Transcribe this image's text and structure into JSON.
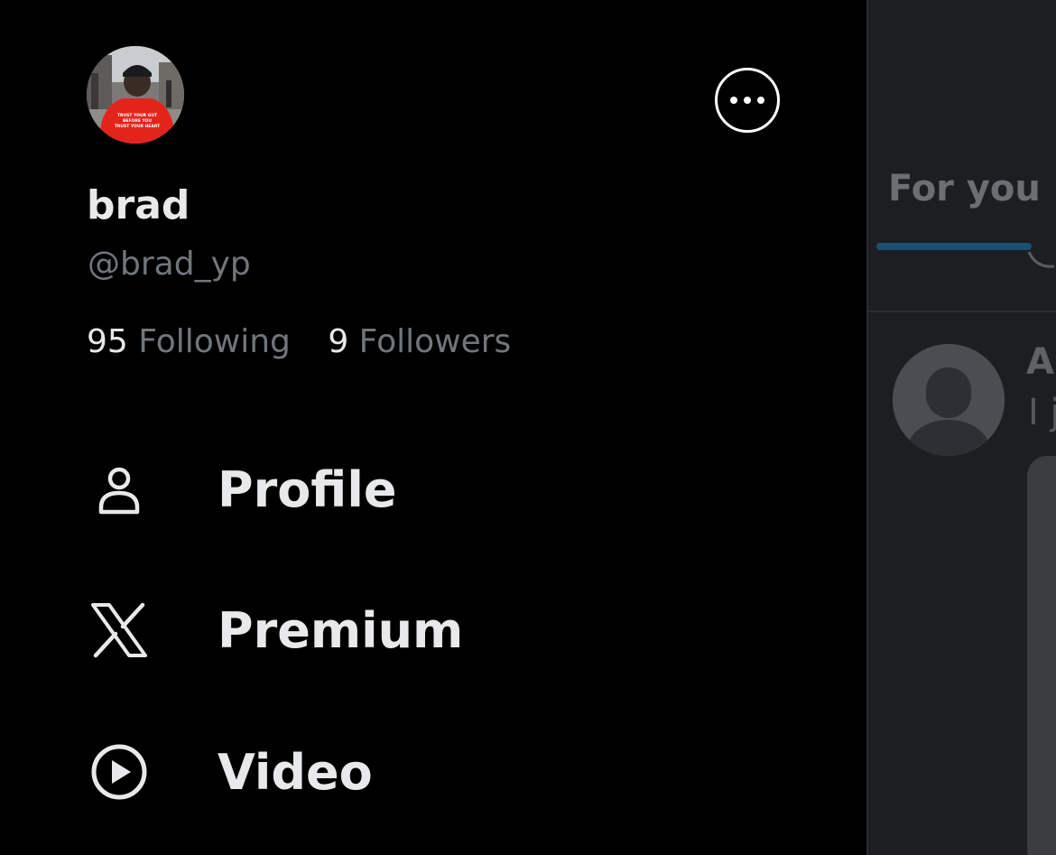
{
  "drawer": {
    "profile": {
      "display_name": "brad",
      "handle": "@brad_yp",
      "avatar_shirt_text": "TRUST YOUR GUT BEFORE YOU TRUST YOUR HEART"
    },
    "stats": {
      "following_count": "95",
      "following_label": "Following",
      "followers_count": "9",
      "followers_label": "Followers"
    },
    "nav": [
      {
        "label": "Profile",
        "icon": "person-icon"
      },
      {
        "label": "Premium",
        "icon": "x-logo-icon"
      },
      {
        "label": "Video",
        "icon": "play-circle-icon"
      }
    ],
    "more_icon": "more-options-icon"
  },
  "timeline": {
    "tab_label": "For you",
    "tweet": {
      "author_partial": "Al",
      "text_partial": "I j"
    }
  },
  "colors": {
    "background": "#000000",
    "primary_text": "#e7e9ea",
    "secondary_text": "#71767b",
    "tab_indicator": "#1d4f73",
    "timeline_bg": "#1c1e21"
  }
}
